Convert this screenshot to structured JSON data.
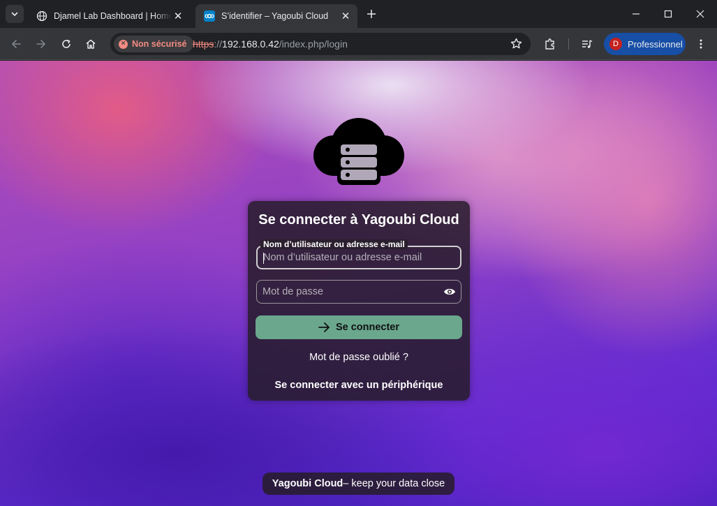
{
  "browser": {
    "tabs": [
      {
        "title": "Djamel Lab Dashboard | HomeLab",
        "active": false,
        "favicon": "globe-icon"
      },
      {
        "title": "S’identifier – Yagoubi Cloud",
        "active": true,
        "favicon": "nextcloud-icon"
      }
    ],
    "address": {
      "security_label": "Non sécurisé",
      "scheme": "https",
      "separator": "://",
      "host": "192.168.0.42",
      "path": "/index.php/login"
    },
    "profile": {
      "initial": "D",
      "label": "Professionnel"
    }
  },
  "login": {
    "title": "Se connecter à Yagoubi Cloud",
    "username_label": "Nom d’utilisateur ou adresse e-mail",
    "username_placeholder": "Nom d’utilisateur ou adresse e-mail",
    "username_value": "",
    "password_placeholder": "Mot de passe",
    "password_value": "",
    "submit_label": "Se connecter",
    "forgot_label": "Mot de passe oublié ?",
    "device_label": "Se connecter avec un périphérique"
  },
  "footer": {
    "brand": "Yagoubi Cloud",
    "tagline": " – keep your data close"
  },
  "colors": {
    "login_button": "#6aa78d",
    "insecure": "#f28b82",
    "profile_chip": "#174ea6"
  }
}
